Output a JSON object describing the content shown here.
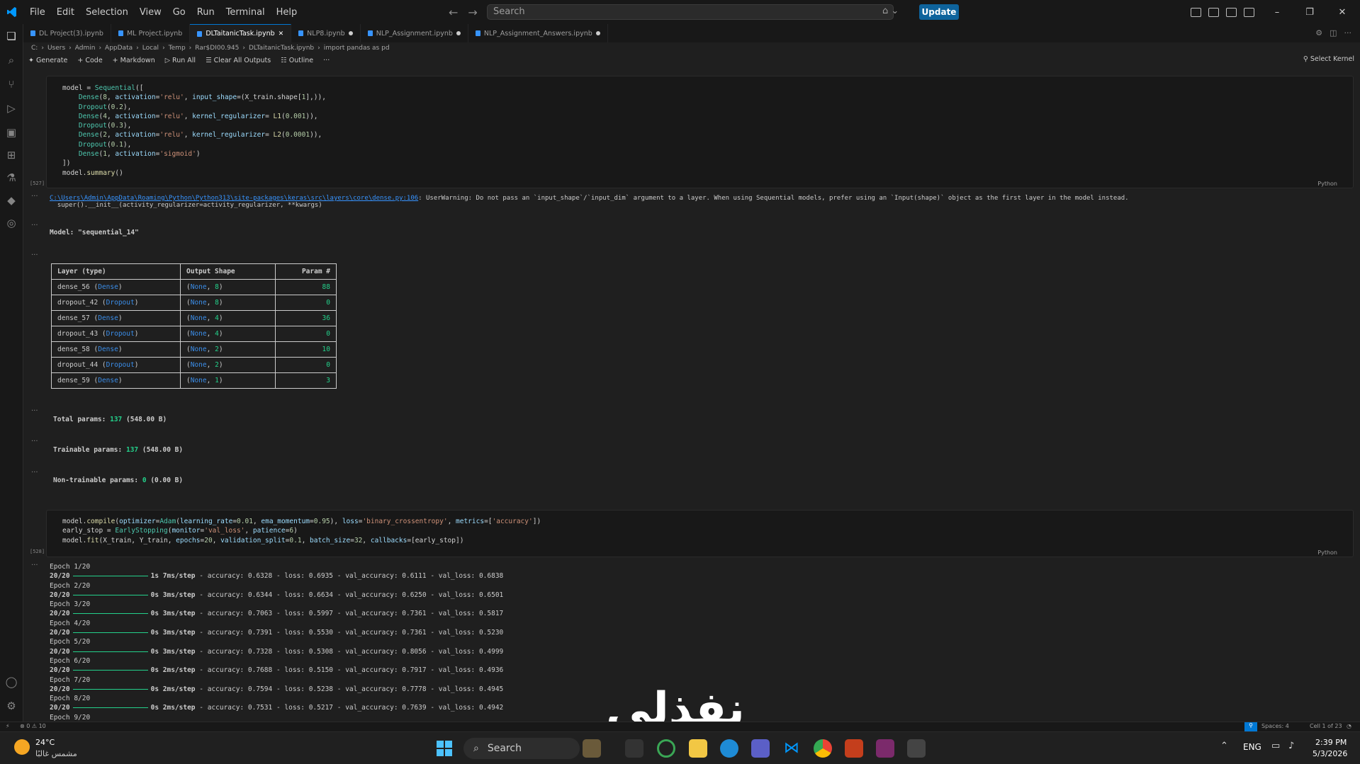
{
  "menu": [
    "File",
    "Edit",
    "Selection",
    "View",
    "Go",
    "Run",
    "Terminal",
    "Help"
  ],
  "search_placeholder": "Search",
  "update_label": "Update",
  "tabs": [
    {
      "label": "DL Project(3).ipynb",
      "active": false,
      "dirty": false
    },
    {
      "label": "ML Project.ipynb",
      "active": false,
      "dirty": false
    },
    {
      "label": "DLTaitanicTask.ipynb",
      "active": true,
      "dirty": false
    },
    {
      "label": "NLP8.ipynb",
      "active": false,
      "dirty": true
    },
    {
      "label": "NLP_Assignment.ipynb",
      "active": false,
      "dirty": true
    },
    {
      "label": "NLP_Assignment_Answers.ipynb",
      "active": false,
      "dirty": true
    }
  ],
  "breadcrumb": [
    "C:",
    "Users",
    "Admin",
    "AppData",
    "Local",
    "Temp",
    "Rar$DI00.945",
    "DLTaitanicTask.ipynb",
    "import pandas as pd"
  ],
  "toolbar": {
    "generate": "Generate",
    "code": "Code",
    "markdown": "Markdown",
    "run_all": "Run All",
    "clear_all": "Clear All Outputs",
    "outline": "Outline",
    "more": "···",
    "select_kernel": "Select Kernel"
  },
  "cell1": {
    "exec": "[527]",
    "lang": "Python"
  },
  "cell2": {
    "exec": "[528]",
    "lang": "Python"
  },
  "warning": {
    "path": "C:\\Users\\Admin\\AppData\\Roaming\\Python\\Python313\\site-packages\\keras\\src\\layers\\core\\dense.py:106",
    "message": ": UserWarning: Do not pass an `input_shape`/`input_dim` argument to a layer. When using Sequential models, prefer using an `Input(shape)` object as the first layer in the model instead.",
    "line2": "  super().__init__(activity_regularizer=activity_regularizer, **kwargs)"
  },
  "model_title": "Model: \"sequential_14\"",
  "summary": {
    "headers": [
      "Layer (type)",
      "Output Shape",
      "Param #"
    ],
    "rows": [
      {
        "name": "dense_56",
        "type": "Dense",
        "dim": "8",
        "params": "88"
      },
      {
        "name": "dropout_42",
        "type": "Dropout",
        "dim": "8",
        "params": "0"
      },
      {
        "name": "dense_57",
        "type": "Dense",
        "dim": "4",
        "params": "36"
      },
      {
        "name": "dropout_43",
        "type": "Dropout",
        "dim": "4",
        "params": "0"
      },
      {
        "name": "dense_58",
        "type": "Dense",
        "dim": "2",
        "params": "10"
      },
      {
        "name": "dropout_44",
        "type": "Dropout",
        "dim": "2",
        "params": "0"
      },
      {
        "name": "dense_59",
        "type": "Dense",
        "dim": "1",
        "params": "3"
      }
    ]
  },
  "totals": {
    "total_label": "Total params:",
    "total_num": "137",
    "total_rest": "(548.00 B)",
    "train_label": "Trainable params:",
    "train_num": "137",
    "train_rest": "(548.00 B)",
    "non_label": "Non-trainable params:",
    "non_num": "0",
    "non_rest": "(0.00 B)"
  },
  "epochs": [
    {
      "epoch": "Epoch 1/20",
      "step": "20/20",
      "time": "1s 7ms/step",
      "acc": "0.6328",
      "loss": "0.6935",
      "val_acc": "0.6111",
      "val_loss": "0.6838"
    },
    {
      "epoch": "Epoch 2/20",
      "step": "20/20",
      "time": "0s 3ms/step",
      "acc": "0.6344",
      "loss": "0.6634",
      "val_acc": "0.6250",
      "val_loss": "0.6501"
    },
    {
      "epoch": "Epoch 3/20",
      "step": "20/20",
      "time": "0s 3ms/step",
      "acc": "0.7063",
      "loss": "0.5997",
      "val_acc": "0.7361",
      "val_loss": "0.5817"
    },
    {
      "epoch": "Epoch 4/20",
      "step": "20/20",
      "time": "0s 3ms/step",
      "acc": "0.7391",
      "loss": "0.5530",
      "val_acc": "0.7361",
      "val_loss": "0.5230"
    },
    {
      "epoch": "Epoch 5/20",
      "step": "20/20",
      "time": "0s 3ms/step",
      "acc": "0.7328",
      "loss": "0.5308",
      "val_acc": "0.8056",
      "val_loss": "0.4999"
    },
    {
      "epoch": "Epoch 6/20",
      "step": "20/20",
      "time": "0s 2ms/step",
      "acc": "0.7688",
      "loss": "0.5150",
      "val_acc": "0.7917",
      "val_loss": "0.4936"
    },
    {
      "epoch": "Epoch 7/20",
      "step": "20/20",
      "time": "0s 2ms/step",
      "acc": "0.7594",
      "loss": "0.5238",
      "val_acc": "0.7778",
      "val_loss": "0.4945"
    },
    {
      "epoch": "Epoch 8/20",
      "step": "20/20",
      "time": "0s 2ms/step",
      "acc": "0.7531",
      "loss": "0.5217",
      "val_acc": "0.7639",
      "val_loss": "0.4942"
    }
  ],
  "epoch_last": "Epoch 9/20",
  "status": {
    "problems": "⊗ 0 ⚠ 10",
    "spaces": "Spaces: 4",
    "cell": "Cell 1 of 23"
  },
  "taskbar": {
    "weather_temp": "24°C",
    "weather_desc": "مشمس غالبًا",
    "search": "Search",
    "lang": "ENG",
    "time": "2:39 PM",
    "date": "5/3/2026"
  },
  "watermark": "نفذلي",
  "colors": {
    "accent": "#0078d4",
    "update": "#0e639c",
    "green": "#23d18b",
    "blue": "#3b8eea"
  }
}
